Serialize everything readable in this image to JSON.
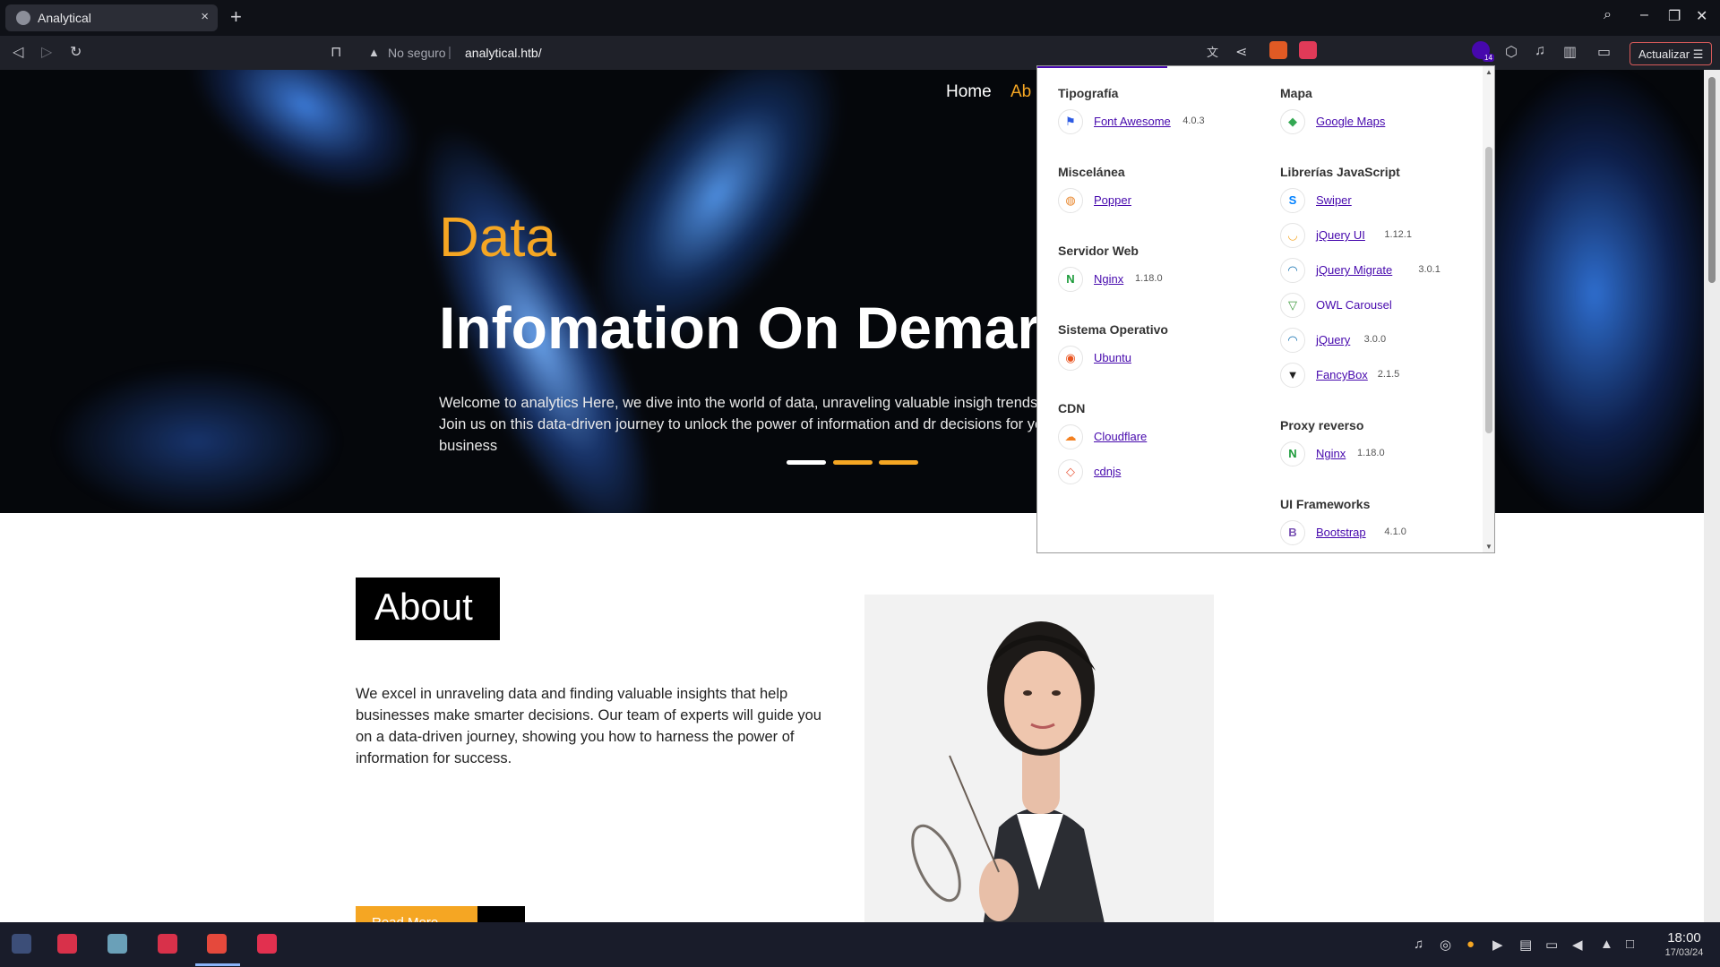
{
  "browser": {
    "tab_title": "Analytical",
    "tab_close": "×",
    "new_tab": "+",
    "url_security": "No seguro",
    "url_separator": "|",
    "url": "analytical.htb/",
    "update_button": "Actualizar ☰",
    "extension_badge_count": "14",
    "window_controls": [
      "⌕",
      "–",
      "❐",
      "✕"
    ]
  },
  "site": {
    "nav": {
      "home": "Home",
      "about": "Ab"
    },
    "hero": {
      "small_heading": "Data",
      "big_heading": "Infomation On Demar",
      "text": "Welcome to analytics Here, we dive into the world of data, unraveling valuable insigh trends. Join us on this data-driven journey to unlock the power of information and dr decisions for your business"
    },
    "about": {
      "heading": "About",
      "text": "We excel in unraveling data and finding valuable insights that help businesses make smarter decisions. Our team of experts will guide you on a data-driven journey, showing you how to harness the power of information for success.",
      "button": "Read More"
    }
  },
  "wappalyzer": {
    "left": [
      {
        "category": "Tipografía",
        "items": [
          {
            "icon": "flag-icon",
            "glyph": "⚑",
            "color": "#2d5be3",
            "name": "Font Awesome",
            "version": "4.0.3"
          }
        ]
      },
      {
        "category": "Miscelánea",
        "items": [
          {
            "icon": "popper-icon",
            "glyph": "◍",
            "color": "#e8862c",
            "name": "Popper",
            "version": ""
          }
        ]
      },
      {
        "category": "Servidor Web",
        "items": [
          {
            "icon": "nginx-icon",
            "glyph": "N",
            "color": "#1c9b3a",
            "name": "Nginx",
            "version": "1.18.0"
          }
        ]
      },
      {
        "category": "Sistema Operativo",
        "items": [
          {
            "icon": "ubuntu-icon",
            "glyph": "◉",
            "color": "#e95420",
            "name": "Ubuntu",
            "version": ""
          }
        ]
      },
      {
        "category": "CDN",
        "items": [
          {
            "icon": "cloudflare-icon",
            "glyph": "☁",
            "color": "#f38020",
            "name": "Cloudflare",
            "version": ""
          },
          {
            "icon": "cdnjs-icon",
            "glyph": "◇",
            "color": "#e9593b",
            "name": "cdnjs",
            "version": ""
          }
        ]
      }
    ],
    "right": [
      {
        "category": "Mapa",
        "items": [
          {
            "icon": "google-maps-icon",
            "glyph": "◆",
            "color": "#34a853",
            "name": "Google Maps",
            "version": ""
          }
        ]
      },
      {
        "category": "Librerías JavaScript",
        "items": [
          {
            "icon": "swiper-icon",
            "glyph": "S",
            "color": "#0080ff",
            "name": "Swiper",
            "version": ""
          },
          {
            "icon": "jquery-ui-icon",
            "glyph": "◡",
            "color": "#f6a828",
            "name": "jQuery UI",
            "version": "1.12.1"
          },
          {
            "icon": "jquery-migrate-icon",
            "glyph": "◠",
            "color": "#0769ad",
            "name": "jQuery Migrate",
            "version": "3.0.1"
          },
          {
            "icon": "owl-carousel-icon",
            "glyph": "▽",
            "color": "#3c9a3c",
            "name": "OWL Carousel",
            "version": ""
          },
          {
            "icon": "jquery-icon",
            "glyph": "◠",
            "color": "#0769ad",
            "name": "jQuery",
            "version": "3.0.0"
          },
          {
            "icon": "fancybox-icon",
            "glyph": "▼",
            "color": "#222222",
            "name": "FancyBox",
            "version": "2.1.5"
          }
        ]
      },
      {
        "category": "Proxy reverso",
        "items": [
          {
            "icon": "nginx-icon",
            "glyph": "N",
            "color": "#1c9b3a",
            "name": "Nginx",
            "version": "1.18.0"
          }
        ]
      },
      {
        "category": "UI Frameworks",
        "items": [
          {
            "icon": "bootstrap-icon",
            "glyph": "B",
            "color": "#7952b3",
            "name": "Bootstrap",
            "version": "4.1.0"
          }
        ]
      }
    ]
  },
  "taskbar": {
    "time": "18:00",
    "date": "17/03/24"
  },
  "colors": {
    "accent_orange": "#f5a623",
    "wappalyzer_purple": "#4608ad",
    "hero_background": "#05070b"
  }
}
